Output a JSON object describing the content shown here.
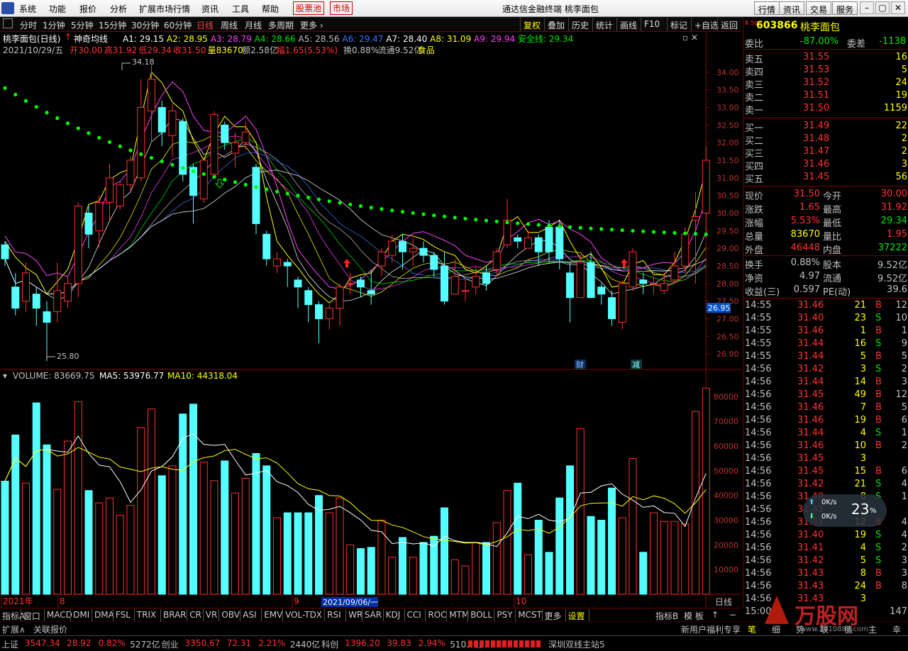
{
  "menubar": {
    "items": [
      "系统",
      "功能",
      "报价",
      "分析",
      "扩展市场行情",
      "资讯",
      "工具",
      "帮助"
    ],
    "hl1": "股票池",
    "hl2": "市场",
    "title": "通达信金融终端  桃李面包",
    "right": [
      "行情",
      "资讯",
      "交易",
      "服务"
    ]
  },
  "toolbar": {
    "periods": [
      "分时",
      "1分钟",
      "5分钟",
      "15分钟",
      "30分钟",
      "60分钟",
      "日线",
      "周线",
      "月线",
      "多周期",
      "更多 ›"
    ],
    "selected": "日线",
    "right": [
      "复权",
      "叠加",
      "历史",
      "统计",
      "画线",
      "F10",
      "标记",
      "+自选",
      "返回"
    ]
  },
  "info": {
    "stock": "桃李面包(日线)",
    "indicator": "神奇均线",
    "ma": [
      {
        "k": "A1: 29.15",
        "c": "#ffffff"
      },
      {
        "k": "A2: 28.95",
        "c": "#ffff00"
      },
      {
        "k": "A3: 28.79",
        "c": "#ff40ff"
      },
      {
        "k": "A4: 28.66",
        "c": "#00e600"
      },
      {
        "k": "A5: 28.56",
        "c": "#c0c0c0"
      },
      {
        "k": "A6: 29.47",
        "c": "#3c78ff"
      },
      {
        "k": "A7: 28.40",
        "c": "#ffffff"
      },
      {
        "k": "A8: 31.09",
        "c": "#ffff00"
      },
      {
        "k": "A9: 29.94",
        "c": "#ff40ff"
      },
      {
        "k": "安全线: 29.34",
        "c": "#00e600"
      }
    ],
    "line2": [
      {
        "t": "2021/10/29/五",
        "c": "#c0c0c0"
      },
      {
        "t": "开30.00",
        "c": "#ff3232"
      },
      {
        "t": "高31.92",
        "c": "#ff3232"
      },
      {
        "t": "低29.34",
        "c": "#ff3232"
      },
      {
        "t": "收31.50",
        "c": "#ff3232"
      },
      {
        "t": "量83670",
        "c": "#ffff00"
      },
      {
        "t": "额2.58亿",
        "c": "#c0c0c0"
      },
      {
        "t": "幅1.65(5.53%)",
        "c": "#ff3232"
      },
      {
        "t": "换0.88%",
        "c": "#c0c0c0"
      },
      {
        "t": "流通9.52亿",
        "c": "#c0c0c0"
      },
      {
        "t": "食品",
        "c": "#ffff00"
      }
    ]
  },
  "chart_data": {
    "type": "candlestick",
    "title": "桃李面包(日线)",
    "price_axis": {
      "ticks": [
        "34.00",
        "33.50",
        "33.00",
        "32.50",
        "32.00",
        "31.50",
        "31.00",
        "30.50",
        "30.00",
        "29.50",
        "29.00",
        "28.50",
        "28.00",
        "27.50",
        "27.00",
        "26.50",
        "26.00"
      ],
      "range": [
        25.6,
        34.5
      ],
      "current_label": "26.95"
    },
    "annotations": {
      "high": "34.18",
      "low": "25.80",
      "fin": "财",
      "red": "减"
    },
    "candles": [
      [
        29.1,
        28.7,
        29.2,
        28.5
      ],
      [
        27.9,
        27.3,
        28.3,
        27.1
      ],
      [
        27.5,
        28.3,
        28.6,
        27.2
      ],
      [
        27.7,
        27.3,
        27.9,
        26.8
      ],
      [
        27.2,
        26.9,
        27.5,
        25.8
      ],
      [
        27.2,
        27.8,
        28.6,
        26.9
      ],
      [
        27.5,
        28.0,
        28.2,
        27.3
      ],
      [
        28.0,
        30.2,
        30.3,
        27.6
      ],
      [
        30.0,
        29.4,
        30.2,
        29.0
      ],
      [
        29.5,
        30.3,
        30.5,
        29.0
      ],
      [
        30.3,
        31.0,
        31.4,
        29.8
      ],
      [
        30.2,
        30.8,
        30.9,
        30.1
      ],
      [
        30.8,
        31.5,
        31.6,
        30.6
      ],
      [
        31.0,
        33.0,
        33.8,
        30.9
      ],
      [
        32.9,
        33.8,
        34.2,
        32.0
      ],
      [
        33.0,
        32.3,
        33.2,
        31.9
      ],
      [
        32.2,
        32.9,
        33.1,
        31.6
      ],
      [
        32.6,
        31.1,
        32.7,
        30.9
      ],
      [
        31.3,
        30.5,
        31.4,
        29.7
      ],
      [
        30.4,
        31.5,
        31.6,
        30.3
      ],
      [
        31.1,
        32.8,
        32.9,
        31.1
      ],
      [
        32.5,
        32.0,
        32.6,
        31.8
      ],
      [
        31.7,
        32.0,
        32.3,
        31.3
      ],
      [
        32.0,
        32.3,
        32.6,
        31.8
      ],
      [
        31.3,
        29.7,
        31.4,
        29.4
      ],
      [
        29.4,
        28.7,
        29.5,
        28.5
      ],
      [
        28.5,
        28.7,
        28.9,
        28.3
      ],
      [
        28.6,
        28.5,
        28.7,
        27.9
      ],
      [
        28.1,
        27.9,
        28.2,
        27.3
      ],
      [
        27.8,
        27.4,
        27.9,
        26.9
      ],
      [
        27.4,
        27.0,
        27.5,
        26.3
      ],
      [
        27.0,
        27.3,
        27.4,
        26.7
      ],
      [
        27.3,
        27.9,
        28.0,
        26.8
      ],
      [
        28.0,
        28.0,
        28.3,
        27.7
      ],
      [
        28.1,
        27.9,
        28.2,
        27.6
      ],
      [
        27.8,
        27.7,
        28.4,
        27.4
      ],
      [
        28.5,
        28.9,
        29.0,
        28.2
      ],
      [
        28.8,
        29.2,
        29.4,
        28.6
      ],
      [
        29.2,
        28.9,
        29.4,
        28.4
      ],
      [
        28.9,
        29.0,
        29.3,
        28.5
      ],
      [
        29.0,
        28.8,
        29.2,
        28.6
      ],
      [
        28.8,
        28.4,
        28.9,
        28.2
      ],
      [
        28.5,
        27.5,
        28.9,
        27.4
      ],
      [
        27.7,
        28.2,
        28.7,
        27.7
      ],
      [
        27.8,
        27.8,
        28.1,
        27.5
      ],
      [
        27.9,
        28.2,
        28.5,
        27.7
      ],
      [
        28.3,
        28.0,
        28.5,
        27.8
      ],
      [
        28.4,
        28.9,
        29.0,
        28.2
      ],
      [
        29.1,
        29.8,
        30.4,
        29.0
      ],
      [
        29.3,
        29.2,
        29.4,
        29.0
      ],
      [
        29.0,
        29.3,
        29.5,
        29.0
      ],
      [
        29.3,
        28.9,
        29.4,
        28.5
      ],
      [
        29.6,
        28.9,
        29.8,
        28.6
      ],
      [
        29.6,
        28.7,
        29.8,
        28.4
      ],
      [
        28.3,
        27.6,
        28.6,
        26.9
      ],
      [
        27.6,
        28.6,
        28.8,
        27.6
      ],
      [
        28.6,
        27.6,
        28.9,
        27.6
      ],
      [
        27.9,
        27.7,
        28.0,
        27.4
      ],
      [
        27.6,
        27.0,
        27.8,
        26.8
      ],
      [
        26.9,
        28.0,
        28.1,
        26.7
      ],
      [
        27.9,
        28.9,
        29.0,
        27.8
      ],
      [
        28.1,
        28.0,
        28.3,
        27.7
      ],
      [
        28.0,
        28.0,
        28.2,
        27.7
      ],
      [
        27.8,
        28.0,
        28.3,
        27.7
      ],
      [
        28.1,
        28.5,
        28.9,
        28.0
      ],
      [
        28.5,
        29.4,
        29.6,
        28.3
      ],
      [
        29.8,
        29.9,
        30.6,
        28.0
      ],
      [
        30.0,
        31.5,
        31.9,
        29.3
      ]
    ],
    "volume": {
      "title": "VOLUME: 83669.75",
      "ma5": "MA5: 53976.77",
      "ma10": "MA10: 44318.04",
      "ticks": [
        "80000",
        "70000",
        "60000",
        "50000",
        "40000",
        "30000",
        "20000",
        "10000"
      ],
      "values": [
        45800,
        64500,
        45000,
        77500,
        60500,
        42500,
        62000,
        78000,
        42000,
        37000,
        39000,
        32000,
        36000,
        67500,
        75000,
        48000,
        52000,
        73000,
        77000,
        53500,
        46000,
        54000,
        41000,
        47000,
        57000,
        52000,
        31000,
        33000,
        33000,
        33000,
        40000,
        33000,
        39000,
        20000,
        18500,
        19000,
        30000,
        15000,
        23000,
        15000,
        21000,
        23500,
        35000,
        14000,
        11500,
        21000,
        21000,
        29000,
        42000,
        45000,
        16000,
        30000,
        17000,
        39000,
        52000,
        67000,
        31500,
        30000,
        43000,
        31000,
        55000,
        17000,
        33000,
        29500,
        29500,
        28500,
        74000,
        83500
      ]
    },
    "xaxis": {
      "labels": [
        "2021年",
        "8",
        "9",
        "2021/09/06/一",
        "10"
      ]
    }
  },
  "quote": {
    "code": "603866",
    "name": "桃李面包",
    "webi": {
      "label": "委比",
      "v": "-87.00%",
      "label2": "委差",
      "v2": "-1138"
    },
    "sell": [
      {
        "k": "卖五",
        "p": "31.55",
        "v": "16"
      },
      {
        "k": "卖四",
        "p": "31.53",
        "v": "5"
      },
      {
        "k": "卖三",
        "p": "31.52",
        "v": "24"
      },
      {
        "k": "卖二",
        "p": "31.51",
        "v": "19"
      },
      {
        "k": "卖一",
        "p": "31.50",
        "v": "1159"
      }
    ],
    "buy": [
      {
        "k": "买一",
        "p": "31.49",
        "v": "22"
      },
      {
        "k": "买二",
        "p": "31.48",
        "v": "2"
      },
      {
        "k": "买三",
        "p": "31.47",
        "v": "2"
      },
      {
        "k": "买四",
        "p": "31.46",
        "v": "3"
      },
      {
        "k": "买五",
        "p": "31.45",
        "v": "56"
      }
    ],
    "stats": [
      {
        "k": "现价",
        "v": "31.50",
        "c": "#ff3232",
        "k2": "今开",
        "v2": "30.00",
        "c2": "#ff3232"
      },
      {
        "k": "涨跌",
        "v": "1.65",
        "c": "#ff3232",
        "k2": "最高",
        "v2": "31.92",
        "c2": "#ff3232"
      },
      {
        "k": "涨幅",
        "v": "5.53%",
        "c": "#ff3232",
        "k2": "最低",
        "v2": "29.34",
        "c2": "#00e600"
      },
      {
        "k": "总量",
        "v": "83670",
        "c": "#ffff00",
        "k2": "量比",
        "v2": "1.95",
        "c2": "#ff3232"
      },
      {
        "k": "外盘",
        "v": "46448",
        "c": "#ff3232",
        "k2": "内盘",
        "v2": "37222",
        "c2": "#00e600"
      }
    ],
    "fund": [
      {
        "k": "换手",
        "v": "0.88%",
        "k2": "股本",
        "v2": "9.52亿"
      },
      {
        "k": "净资",
        "v": "4.97",
        "k2": "流通",
        "v2": "9.52亿"
      },
      {
        "k": "收益(三)",
        "v": "0.597",
        "k2": "PE(动)",
        "v2": "39.6"
      }
    ],
    "ticks": [
      [
        "14:55",
        "31.46",
        "21",
        "B",
        "12"
      ],
      [
        "14:55",
        "31.40",
        "23",
        "S",
        "10"
      ],
      [
        "14:55",
        "31.46",
        "1",
        "B",
        "1"
      ],
      [
        "14:55",
        "31.44",
        "16",
        "S",
        "9"
      ],
      [
        "14:55",
        "31.44",
        "5",
        "B",
        "5"
      ],
      [
        "14:56",
        "31.42",
        "3",
        "S",
        "2"
      ],
      [
        "14:56",
        "31.44",
        "14",
        "B",
        "3"
      ],
      [
        "14:56",
        "31.45",
        "49",
        "B",
        "12"
      ],
      [
        "14:56",
        "31.46",
        "7",
        "B",
        "5"
      ],
      [
        "14:56",
        "31.46",
        "19",
        "B",
        "6"
      ],
      [
        "14:56",
        "31.44",
        "4",
        "S",
        "1"
      ],
      [
        "14:56",
        "31.46",
        "10",
        "B",
        "2"
      ],
      [
        "14:56",
        "31.45",
        "3",
        "",
        ""
      ],
      [
        "14:56",
        "31.45",
        "15",
        "B",
        "6"
      ],
      [
        "14:56",
        "31.42",
        "21",
        "S",
        "4"
      ],
      [
        "14:56",
        "31.40",
        "8",
        "S",
        "1"
      ],
      [
        "14:56",
        "31.42",
        "",
        "",
        ""
      ],
      [
        "14:56",
        "31.42",
        "12",
        "B",
        "4"
      ],
      [
        "14:56",
        "31.40",
        "19",
        "S",
        "4"
      ],
      [
        "14:56",
        "31.41",
        "4",
        "S",
        "2"
      ],
      [
        "14:56",
        "31.42",
        "5",
        "S",
        "3"
      ],
      [
        "14:56",
        "31.43",
        "8",
        "B",
        "3"
      ],
      [
        "14:56",
        "31.43",
        "24",
        "B",
        "8"
      ],
      [
        "14:56",
        "31.43",
        "3",
        "",
        ""
      ],
      [
        "15:00",
        "",
        "",
        "",
        "147"
      ]
    ]
  },
  "tabs": [
    "指标A",
    "窗口",
    "MACD",
    "DMI",
    "DMA",
    "FSL",
    "TRIX",
    "BRAR",
    "CR",
    "VR",
    "OBV",
    "ASI",
    "EMV",
    "VOL-TDX",
    "RSI",
    "WR",
    "SAR",
    "KDJ",
    "CCI",
    "ROC",
    "MTM",
    "BOLL",
    "PSY",
    "MCST",
    "更多",
    "设置"
  ],
  "tabs_right": [
    "指标B",
    "模 板"
  ],
  "bar2": {
    "left": [
      "扩展∧",
      "关联报价"
    ],
    "right": "新用户福利专享",
    "btns": [
      "笔",
      "细",
      "势",
      "联",
      "值",
      "主",
      "幸"
    ]
  },
  "status": [
    {
      "t": "上证",
      "c": "#c0c0c0"
    },
    {
      "t": "3547.34",
      "c": "#ff3232"
    },
    {
      "t": "28.92",
      "c": "#ff3232"
    },
    {
      "t": "0.82%",
      "c": "#ff3232"
    },
    {
      "t": "5272亿",
      "c": "#c0c0c0"
    },
    {
      "t": "创业",
      "c": "#c0c0c0"
    },
    {
      "t": "3350.67",
      "c": "#ff3232"
    },
    {
      "t": "72.31",
      "c": "#ff3232"
    },
    {
      "t": "2.21%",
      "c": "#ff3232"
    },
    {
      "t": "2440亿",
      "c": "#c0c0c0"
    },
    {
      "t": "科创",
      "c": "#c0c0c0"
    },
    {
      "t": "1396.20",
      "c": "#ff3232"
    },
    {
      "t": "39.83",
      "c": "#ff3232"
    },
    {
      "t": "2.94%",
      "c": "#ff3232"
    },
    {
      "t": "510.0亿",
      "c": "#c0c0c0"
    },
    {
      "t": "深圳双线主站5",
      "c": "#c0c0c0"
    }
  ],
  "float": {
    "up": "0K/s",
    "down": "0K/s",
    "pct": "23",
    "unit": "%"
  },
  "watermark": {
    "text": "万股网",
    "url": "www.2010888.com"
  }
}
